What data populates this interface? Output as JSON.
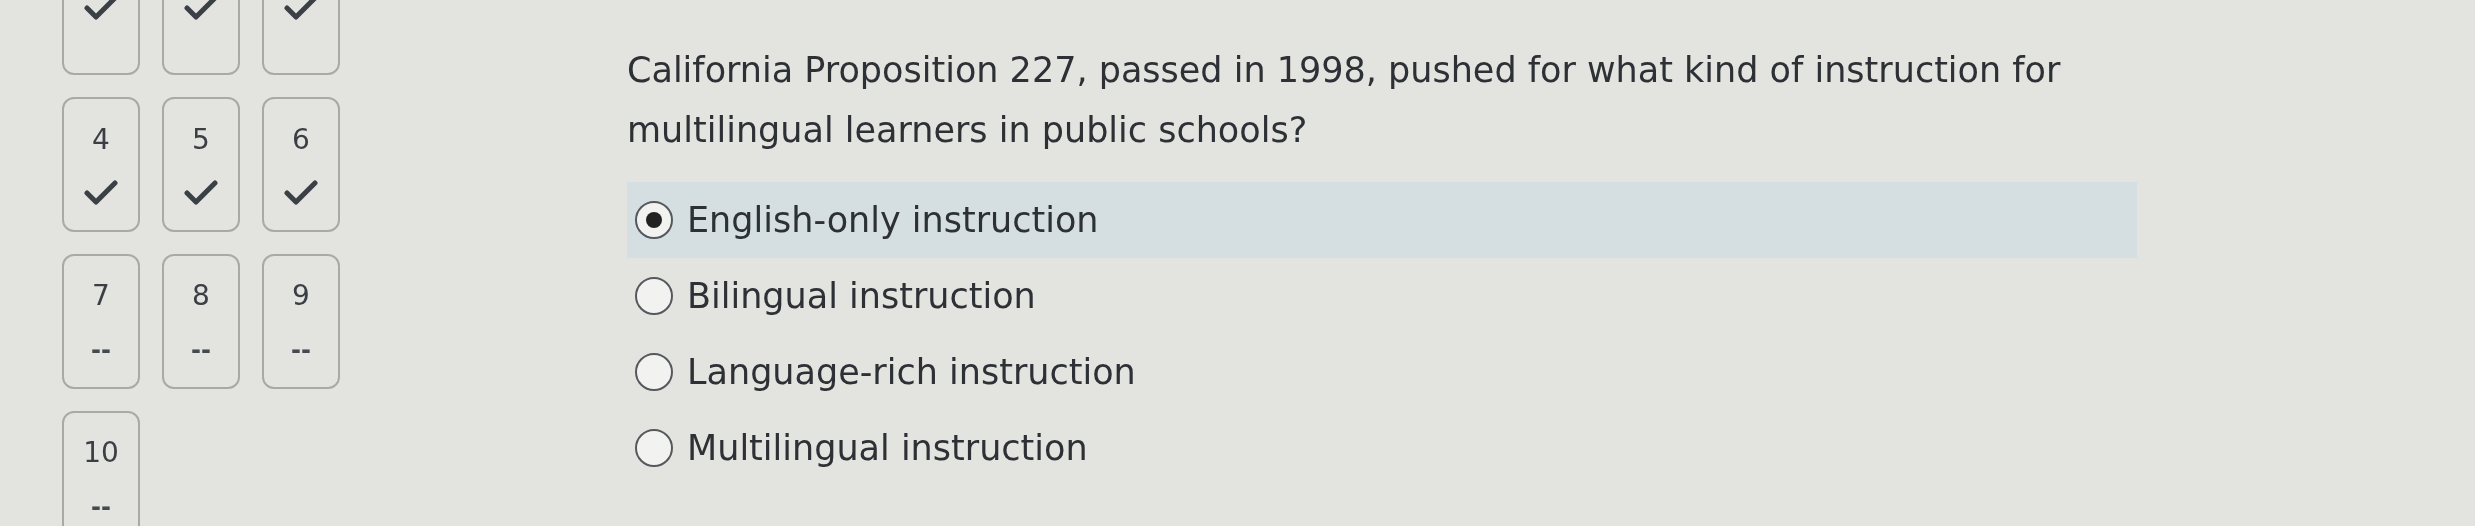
{
  "question_nav": [
    {
      "kind": "answered"
    },
    {
      "kind": "answered"
    },
    {
      "kind": "answered"
    },
    {
      "number": "4",
      "kind": "answered"
    },
    {
      "number": "5",
      "kind": "answered"
    },
    {
      "number": "6",
      "kind": "answered"
    },
    {
      "number": "7",
      "kind": "unanswered",
      "mark": "--"
    },
    {
      "number": "8",
      "kind": "unanswered",
      "mark": "--"
    },
    {
      "number": "9",
      "kind": "unanswered",
      "mark": "--"
    },
    {
      "number": "10",
      "kind": "unanswered",
      "mark": "--"
    }
  ],
  "question": {
    "text": "California Proposition 227, passed in 1998, pushed for what kind of instruction for multilingual learners in public schools?",
    "options": [
      {
        "label": "English-only instruction",
        "selected": true
      },
      {
        "label": "Bilingual instruction",
        "selected": false
      },
      {
        "label": "Language-rich instruction",
        "selected": false
      },
      {
        "label": "Multilingual instruction",
        "selected": false
      }
    ]
  }
}
